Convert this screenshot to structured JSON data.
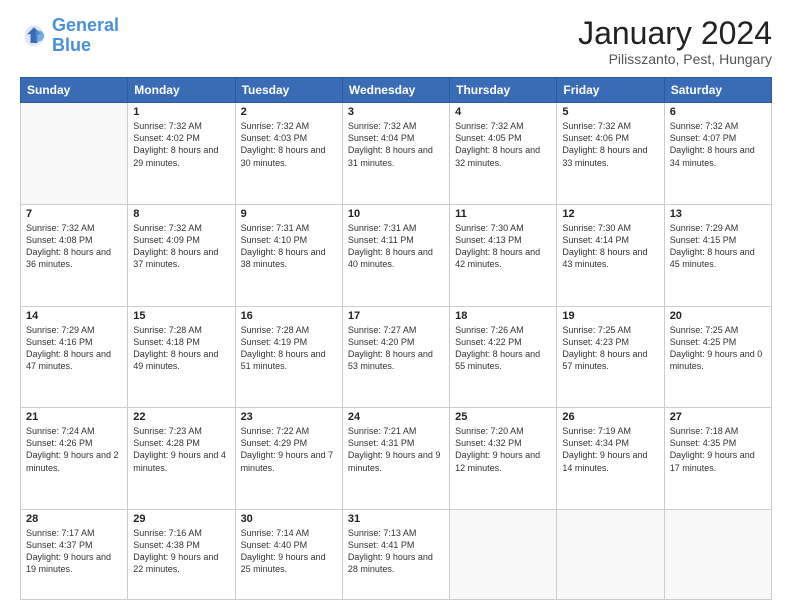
{
  "header": {
    "logo_line1": "General",
    "logo_line2": "Blue",
    "title": "January 2024",
    "location": "Pilisszanto, Pest, Hungary"
  },
  "weekdays": [
    "Sunday",
    "Monday",
    "Tuesday",
    "Wednesday",
    "Thursday",
    "Friday",
    "Saturday"
  ],
  "weeks": [
    [
      {
        "day": "",
        "sunrise": "",
        "sunset": "",
        "daylight": ""
      },
      {
        "day": "1",
        "sunrise": "7:32 AM",
        "sunset": "4:02 PM",
        "daylight": "8 hours and 29 minutes."
      },
      {
        "day": "2",
        "sunrise": "7:32 AM",
        "sunset": "4:03 PM",
        "daylight": "8 hours and 30 minutes."
      },
      {
        "day": "3",
        "sunrise": "7:32 AM",
        "sunset": "4:04 PM",
        "daylight": "8 hours and 31 minutes."
      },
      {
        "day": "4",
        "sunrise": "7:32 AM",
        "sunset": "4:05 PM",
        "daylight": "8 hours and 32 minutes."
      },
      {
        "day": "5",
        "sunrise": "7:32 AM",
        "sunset": "4:06 PM",
        "daylight": "8 hours and 33 minutes."
      },
      {
        "day": "6",
        "sunrise": "7:32 AM",
        "sunset": "4:07 PM",
        "daylight": "8 hours and 34 minutes."
      }
    ],
    [
      {
        "day": "7",
        "sunrise": "7:32 AM",
        "sunset": "4:08 PM",
        "daylight": "8 hours and 36 minutes."
      },
      {
        "day": "8",
        "sunrise": "7:32 AM",
        "sunset": "4:09 PM",
        "daylight": "8 hours and 37 minutes."
      },
      {
        "day": "9",
        "sunrise": "7:31 AM",
        "sunset": "4:10 PM",
        "daylight": "8 hours and 38 minutes."
      },
      {
        "day": "10",
        "sunrise": "7:31 AM",
        "sunset": "4:11 PM",
        "daylight": "8 hours and 40 minutes."
      },
      {
        "day": "11",
        "sunrise": "7:30 AM",
        "sunset": "4:13 PM",
        "daylight": "8 hours and 42 minutes."
      },
      {
        "day": "12",
        "sunrise": "7:30 AM",
        "sunset": "4:14 PM",
        "daylight": "8 hours and 43 minutes."
      },
      {
        "day": "13",
        "sunrise": "7:29 AM",
        "sunset": "4:15 PM",
        "daylight": "8 hours and 45 minutes."
      }
    ],
    [
      {
        "day": "14",
        "sunrise": "7:29 AM",
        "sunset": "4:16 PM",
        "daylight": "8 hours and 47 minutes."
      },
      {
        "day": "15",
        "sunrise": "7:28 AM",
        "sunset": "4:18 PM",
        "daylight": "8 hours and 49 minutes."
      },
      {
        "day": "16",
        "sunrise": "7:28 AM",
        "sunset": "4:19 PM",
        "daylight": "8 hours and 51 minutes."
      },
      {
        "day": "17",
        "sunrise": "7:27 AM",
        "sunset": "4:20 PM",
        "daylight": "8 hours and 53 minutes."
      },
      {
        "day": "18",
        "sunrise": "7:26 AM",
        "sunset": "4:22 PM",
        "daylight": "8 hours and 55 minutes."
      },
      {
        "day": "19",
        "sunrise": "7:25 AM",
        "sunset": "4:23 PM",
        "daylight": "8 hours and 57 minutes."
      },
      {
        "day": "20",
        "sunrise": "7:25 AM",
        "sunset": "4:25 PM",
        "daylight": "9 hours and 0 minutes."
      }
    ],
    [
      {
        "day": "21",
        "sunrise": "7:24 AM",
        "sunset": "4:26 PM",
        "daylight": "9 hours and 2 minutes."
      },
      {
        "day": "22",
        "sunrise": "7:23 AM",
        "sunset": "4:28 PM",
        "daylight": "9 hours and 4 minutes."
      },
      {
        "day": "23",
        "sunrise": "7:22 AM",
        "sunset": "4:29 PM",
        "daylight": "9 hours and 7 minutes."
      },
      {
        "day": "24",
        "sunrise": "7:21 AM",
        "sunset": "4:31 PM",
        "daylight": "9 hours and 9 minutes."
      },
      {
        "day": "25",
        "sunrise": "7:20 AM",
        "sunset": "4:32 PM",
        "daylight": "9 hours and 12 minutes."
      },
      {
        "day": "26",
        "sunrise": "7:19 AM",
        "sunset": "4:34 PM",
        "daylight": "9 hours and 14 minutes."
      },
      {
        "day": "27",
        "sunrise": "7:18 AM",
        "sunset": "4:35 PM",
        "daylight": "9 hours and 17 minutes."
      }
    ],
    [
      {
        "day": "28",
        "sunrise": "7:17 AM",
        "sunset": "4:37 PM",
        "daylight": "9 hours and 19 minutes."
      },
      {
        "day": "29",
        "sunrise": "7:16 AM",
        "sunset": "4:38 PM",
        "daylight": "9 hours and 22 minutes."
      },
      {
        "day": "30",
        "sunrise": "7:14 AM",
        "sunset": "4:40 PM",
        "daylight": "9 hours and 25 minutes."
      },
      {
        "day": "31",
        "sunrise": "7:13 AM",
        "sunset": "4:41 PM",
        "daylight": "9 hours and 28 minutes."
      },
      {
        "day": "",
        "sunrise": "",
        "sunset": "",
        "daylight": ""
      },
      {
        "day": "",
        "sunrise": "",
        "sunset": "",
        "daylight": ""
      },
      {
        "day": "",
        "sunrise": "",
        "sunset": "",
        "daylight": ""
      }
    ]
  ],
  "labels": {
    "sunrise_prefix": "Sunrise: ",
    "sunset_prefix": "Sunset: ",
    "daylight_prefix": "Daylight: "
  }
}
